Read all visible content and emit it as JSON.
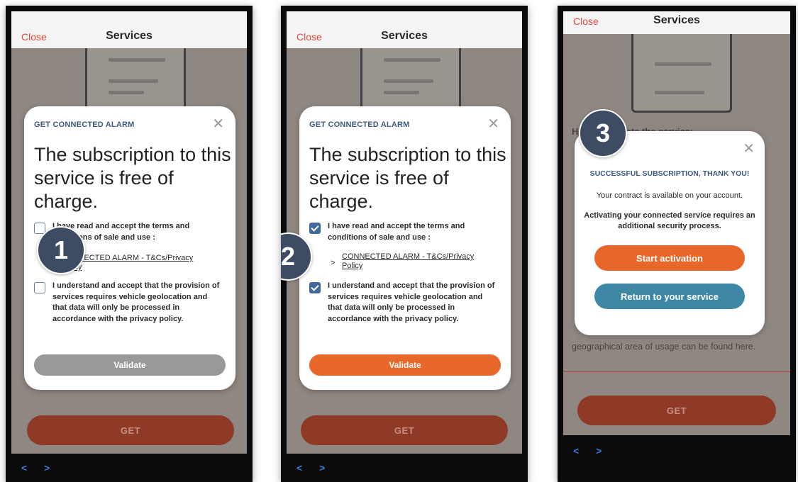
{
  "screen": {
    "title": "Services",
    "close_label": "Close",
    "get_label": "GET",
    "nav_arrows": "< >"
  },
  "step1": {
    "badge": "1",
    "tag": "GET CONNECTED ALARM",
    "headline": "The subscription to this service is free of charge.",
    "terms_text": "I have read and accept the terms and conditions of sale and use :",
    "link_text": "CONNECTED ALARM - T&Cs/Privacy Policy",
    "consent_text": "I understand and accept that the provision of services requires vehicle geolocation and that data will only be processed in accordance with the privacy policy.",
    "validate_label": "Validate"
  },
  "step2": {
    "badge": "2",
    "tag": "GET CONNECTED ALARM",
    "headline": "The subscription to this service is free of charge.",
    "terms_text": "I have read and accept the terms and conditions of sale and use :",
    "link_prefix": ">",
    "link_text": "CONNECTED ALARM - T&Cs/Privacy Policy",
    "consent_text": "I understand and accept that the provision of services requires vehicle geolocation and that data will only be processed in accordance with the privacy policy.",
    "validate_label": "Validate"
  },
  "step3": {
    "badge": "3",
    "bg_heading": "How to activate the service:",
    "bg_footer": "geographical area of usage can be found here.",
    "title": "SUCCESSFUL SUBSCRIPTION, THANK YOU!",
    "contract_text": "Your contract is available on your account.",
    "security_text": "Activating your connected service requires an additional security process.",
    "start_label": "Start activation",
    "return_label": "Return to your service"
  },
  "colors": {
    "accent_orange": "#e8672a",
    "accent_blue": "#3e88a5",
    "disabled_gray": "#999999",
    "brand_navy": "#3d5a80",
    "close_red": "#e0493c"
  },
  "icons": [
    "close-icon",
    "checkbox-icon",
    "back-arrow-icon",
    "forward-arrow-icon"
  ]
}
